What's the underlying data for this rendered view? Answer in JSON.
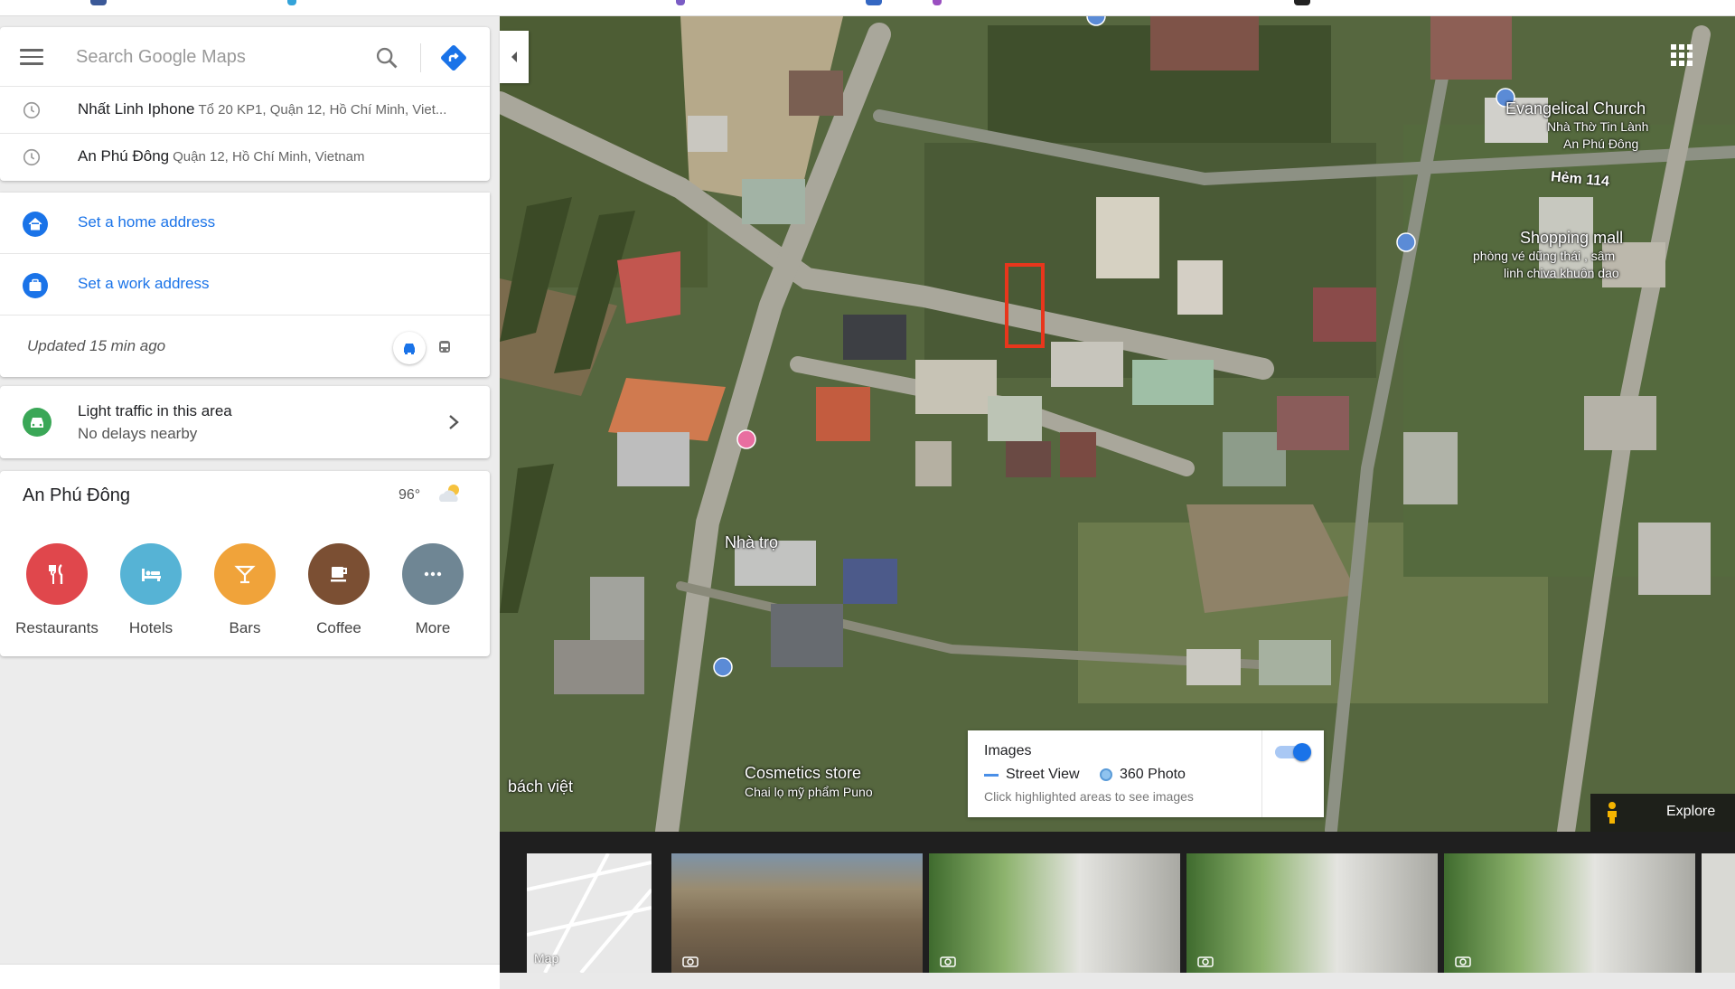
{
  "search": {
    "placeholder": "Search Google Maps",
    "recent": [
      {
        "name": "Nhất Linh Iphone",
        "address": "Tổ 20 KP1, Quận 12, Hồ Chí Minh, Viet..."
      },
      {
        "name": "An Phú Đông",
        "address": "Quận 12, Hồ Chí Minh, Vietnam"
      }
    ]
  },
  "addresses": {
    "home_label": "Set a home address",
    "work_label": "Set a work address",
    "updated": "Updated 15 min ago"
  },
  "traffic": {
    "title": "Light traffic in this area",
    "subtitle": "No delays nearby"
  },
  "place": {
    "title": "An Phú Đông",
    "temperature": "96°",
    "categories": [
      {
        "label": "Restaurants",
        "icon": "restaurant-icon",
        "color": "#e0474c"
      },
      {
        "label": "Hotels",
        "icon": "hotel-icon",
        "color": "#56b3d5"
      },
      {
        "label": "Bars",
        "icon": "bar-icon",
        "color": "#f0a33a"
      },
      {
        "label": "Coffee",
        "icon": "coffee-icon",
        "color": "#7b4f33"
      },
      {
        "label": "More",
        "icon": "more-icon",
        "color": "#6f8694"
      }
    ]
  },
  "map": {
    "labels": {
      "church": "Evangelical Church",
      "church_sub1": "Nhà Thờ Tin Lành",
      "church_sub2": "An Phú Đông",
      "street": "Hẻm 114",
      "mall": "Shopping mall",
      "mall_sub1": "phòng vé dũng thái , sâm",
      "mall_sub2": "linh chiva khuôn dao",
      "motel": "Nhà trọ",
      "cosmetics": "Cosmetics store",
      "cosmetics_sub": "Chai lọ mỹ phẩm Puno",
      "bachviet": "bách việt"
    },
    "images_panel": {
      "title": "Images",
      "street_view": "Street View",
      "photo_360": "360 Photo",
      "hint": "Click highlighted areas to see images",
      "toggle_on": true
    },
    "explore_label": "Explore"
  },
  "filmstrip": {
    "map_label": "Map"
  },
  "colors": {
    "accent": "#1a73e8",
    "traffic_green": "#3aa757",
    "highlight_red": "#e8361c"
  }
}
